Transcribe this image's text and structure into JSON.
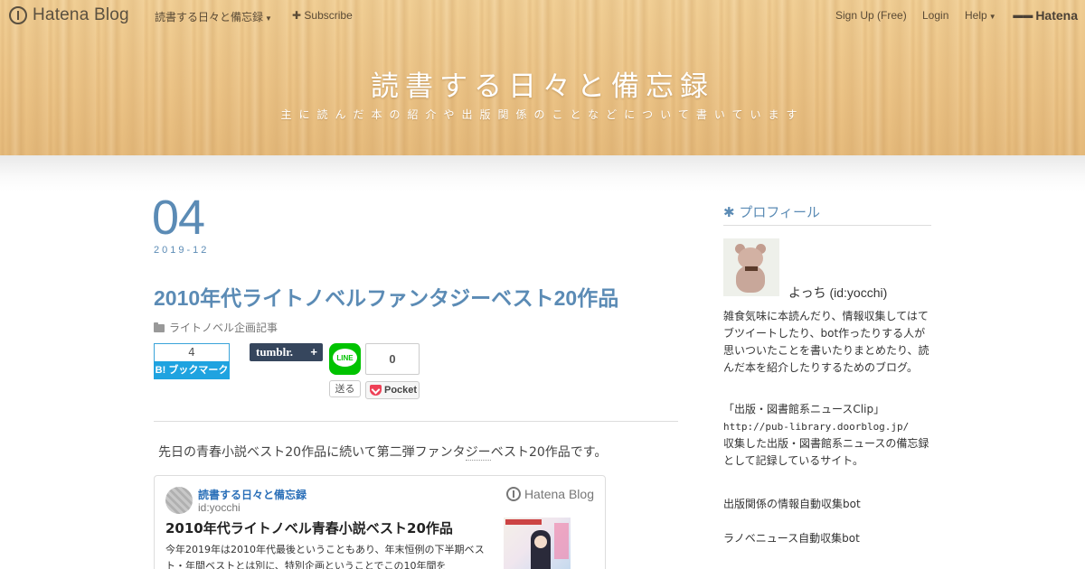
{
  "topbar": {
    "logo": "Hatena Blog",
    "blog_menu": "読書する日々と備忘録",
    "subscribe": "✚ Subscribe",
    "signup": "Sign Up (Free)",
    "login": "Login",
    "help": "Help",
    "brand": "Hatena"
  },
  "header": {
    "title": "読書する日々と備忘録",
    "description": "主に読んだ本の紹介や出版関係のことなどについて書いています"
  },
  "entry": {
    "day": "04",
    "year_month": "2019-12",
    "title": "2010年代ライトノベルファンタジーベスト20作品",
    "category": "ライトノベル企画記事",
    "intro_before": "先日の青春小説ベスト20作品に続いて第二弾ファンタ",
    "intro_dotted": "ジー",
    "intro_after": "ベスト20作品です。"
  },
  "share": {
    "bookmark_count": "4",
    "bookmark_label": "B! ブックマーク",
    "tumblr_label": "tumblr.",
    "tumblr_plus": "+",
    "line_label": "LINE",
    "send_label": "送る",
    "pocket_count": "0",
    "pocket_label": "Pocket"
  },
  "embed": {
    "blog_name": "読書する日々と備忘録",
    "user_id": "id:yocchi",
    "brand": "Hatena Blog",
    "title": "2010年代ライトノベル青春小説ベスト20作品",
    "excerpt": "今年2019年は2010年代最後ということもあり、年末恒例の下半期ベスト・年間ベストとは別に、特別企画ということでこの10年間を"
  },
  "sidebar": {
    "heading": "✱ プロフィール",
    "name": "よっち (id:yocchi)",
    "bio": "雑食気味に本読んだり、情報収集してはてブツイートしたり、bot作ったりする人が思いついたことを書いたりまとめたり、読んだ本を紹介したりするためのブログ。",
    "clip_title": "「出版・図書館系ニュースClip」",
    "clip_url": "http://pub-library.doorblog.jp/",
    "clip_desc": "収集した出版・図書館系ニュースの備忘録として記録しているサイト。",
    "bot1": "出版関係の情報自動収集bot",
    "bot2": "ラノベニュース自動収集bot"
  },
  "colors": {
    "accent": "#5b8bb5",
    "hatena_bookmark": "#1fa3e0",
    "tumblr": "#36465d",
    "line": "#00c300",
    "pocket": "#ee4056"
  }
}
